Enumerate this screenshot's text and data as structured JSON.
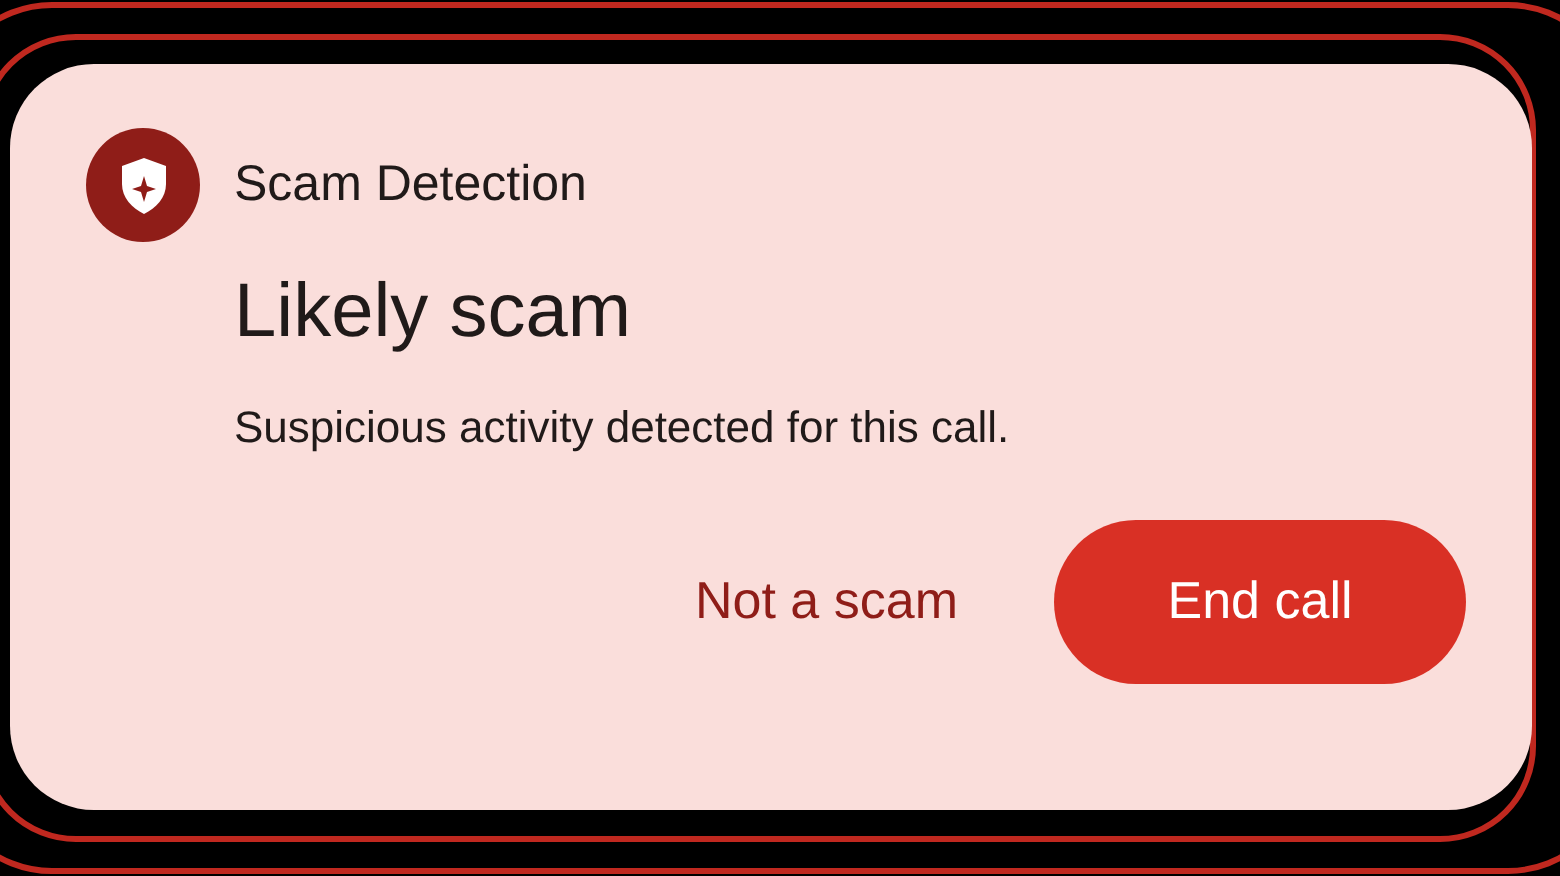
{
  "notification": {
    "app_name": "Scam Detection",
    "title": "Likely scam",
    "message": "Suspicious activity detected for this call.",
    "actions": [
      {
        "kind": "text",
        "label": "Not a scam"
      },
      {
        "kind": "filled",
        "label": "End call"
      }
    ]
  }
}
